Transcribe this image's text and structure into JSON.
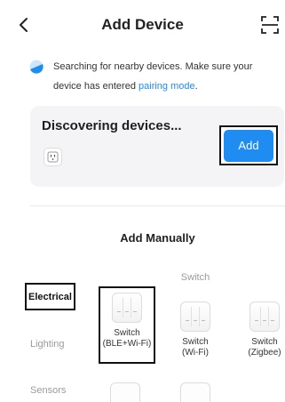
{
  "header": {
    "title": "Add Device",
    "back_icon": "chevron-left-icon",
    "scan_icon": "scan-icon"
  },
  "notice": {
    "text": "Searching for nearby devices. Make sure your device has entered ",
    "link": "pairing mode",
    "suffix": ".",
    "icon": "bluetooth-search-icon",
    "accent": "#1e8cf0"
  },
  "discover": {
    "title": "Discovering devices...",
    "add_label": "Add",
    "device_icon": "socket-icon"
  },
  "manual": {
    "title": "Add Manually",
    "categories": [
      "Electrical",
      "Lighting",
      "Sensors"
    ],
    "active_category": "Electrical",
    "group_label": "Switch",
    "tiles": [
      {
        "line1": "Switch",
        "line2": "(BLE+Wi-Fi)"
      },
      {
        "line1": "Switch",
        "line2": "(Wi-Fi)"
      },
      {
        "line1": "Switch",
        "line2": "(Zigbee)"
      }
    ]
  }
}
